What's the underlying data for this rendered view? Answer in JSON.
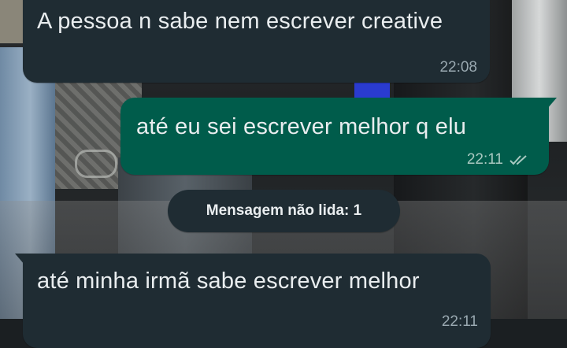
{
  "messages": [
    {
      "direction": "incoming",
      "text": "A pessoa n sabe nem escrever creative",
      "time": "22:08"
    },
    {
      "direction": "outgoing",
      "text": "até eu sei escrever melhor q elu",
      "time": "22:11",
      "status_icon": "double-check-icon"
    },
    {
      "direction": "incoming",
      "text": "até minha irmã sabe escrever melhor",
      "time": "22:11"
    }
  ],
  "unread_banner": {
    "label": "Mensagem não lida: 1"
  },
  "colors": {
    "incoming_bubble": "#1f2c33",
    "outgoing_bubble": "#005c4b",
    "text": "#e9edef",
    "meta_text": "#99a8b0"
  }
}
